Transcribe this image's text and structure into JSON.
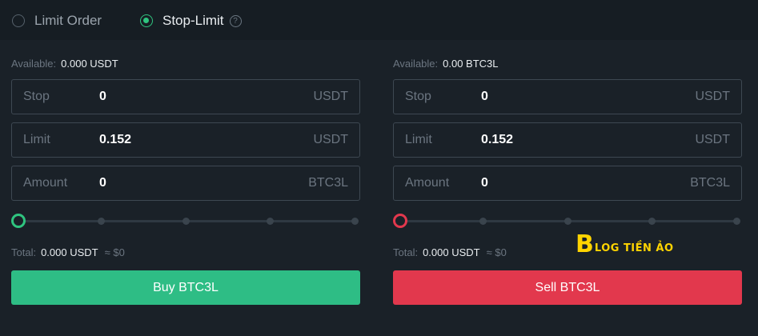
{
  "order_types": {
    "limit_label": "Limit Order",
    "stop_limit_label": "Stop-Limit",
    "help": "?"
  },
  "buy_panel": {
    "available_label": "Available:",
    "available_value": "0.000 USDT",
    "stop": {
      "label": "Stop",
      "value": "0",
      "unit": "USDT"
    },
    "limit": {
      "label": "Limit",
      "value": "0.152",
      "unit": "USDT"
    },
    "amount": {
      "label": "Amount",
      "value": "0",
      "unit": "BTC3L"
    },
    "slider_percent": 0,
    "total_label": "Total:",
    "total_value": "0.000 USDT",
    "total_approx": "≈ $0",
    "button_label": "Buy BTC3L"
  },
  "sell_panel": {
    "available_label": "Available:",
    "available_value": "0.00 BTC3L",
    "stop": {
      "label": "Stop",
      "value": "0",
      "unit": "USDT"
    },
    "limit": {
      "label": "Limit",
      "value": "0.152",
      "unit": "USDT"
    },
    "amount": {
      "label": "Amount",
      "value": "0",
      "unit": "BTC3L"
    },
    "slider_percent": 0,
    "total_label": "Total:",
    "total_value": "0.000 USDT",
    "total_approx": "≈ $0",
    "button_label": "Sell BTC3L"
  },
  "watermark": {
    "letter": "B",
    "text": "LOG TIỀN ẢO"
  },
  "colors": {
    "buy": "#2ebd85",
    "sell": "#e2384d",
    "accent": "#2fc47f",
    "background": "#1a2128"
  }
}
